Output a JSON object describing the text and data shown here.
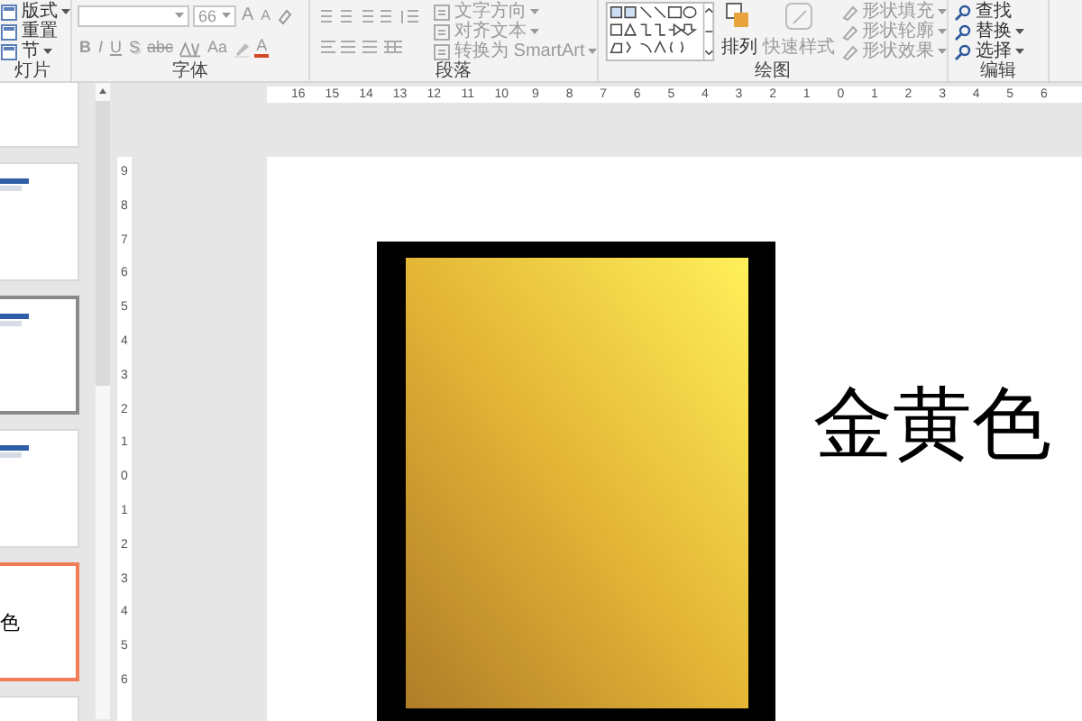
{
  "ribbon": {
    "groups": [
      {
        "kind": "slides",
        "label": "灯片",
        "buttons": [
          {
            "label": "版式",
            "dropdown": true
          },
          {
            "label": "重置",
            "dropdown": false
          },
          {
            "label": "节",
            "dropdown": true
          }
        ]
      },
      {
        "kind": "font",
        "label": "字体",
        "disabled": true,
        "font_size": {
          "value": "66"
        },
        "size_buttons": [
          {
            "label": "A",
            "kind": "grow"
          },
          {
            "label": "A",
            "kind": "shrink"
          }
        ],
        "format_buttons": [
          {
            "label": "B",
            "kind": "bold"
          },
          {
            "label": "I",
            "kind": "italic"
          },
          {
            "label": "U",
            "kind": "underline"
          },
          {
            "label": "S",
            "kind": "shadow"
          },
          {
            "label": "abc",
            "kind": "strike"
          }
        ],
        "case_button": {
          "label": "Aa"
        },
        "color_button": {
          "label": "A"
        }
      },
      {
        "kind": "paragraph",
        "label": "段落",
        "disabled": true,
        "commands": [
          {
            "label": "文字方向",
            "dropdown": true
          },
          {
            "label": "对齐文本",
            "dropdown": true
          },
          {
            "label": "转换为 SmartArt",
            "dropdown": true
          }
        ]
      },
      {
        "kind": "drawing",
        "label": "绘图",
        "arrange": {
          "label": "排列",
          "disabled": false
        },
        "quick_styles": {
          "label": "快速样式",
          "disabled": true
        },
        "commands": [
          {
            "label": "形状填充",
            "disabled": true
          },
          {
            "label": "形状轮廓",
            "disabled": true
          },
          {
            "label": "形状效果",
            "disabled": true
          }
        ]
      },
      {
        "kind": "editing",
        "label": "编辑",
        "commands": [
          {
            "label": "查找",
            "dropdown": false
          },
          {
            "label": "替换",
            "dropdown": true
          },
          {
            "label": "选择",
            "dropdown": true
          }
        ]
      }
    ]
  },
  "slide_panel": {
    "thumbnails": [
      {
        "kind": "blank",
        "selected": false,
        "hovered": false
      },
      {
        "kind": "title-bar",
        "selected": false,
        "hovered": false
      },
      {
        "kind": "title-bar",
        "selected": false,
        "hovered": true
      },
      {
        "kind": "title-bar",
        "selected": false,
        "hovered": false
      },
      {
        "kind": "text",
        "text": "色",
        "selected": true,
        "hovered": false
      },
      {
        "kind": "blank",
        "selected": false,
        "hovered": false
      }
    ]
  },
  "rulers": {
    "horizontal": [
      "16",
      "15",
      "14",
      "13",
      "12",
      "11",
      "10",
      "9",
      "8",
      "7",
      "6",
      "5",
      "4",
      "3",
      "2",
      "1",
      "0",
      "1",
      "2",
      "3",
      "4",
      "5",
      "6"
    ],
    "vertical": [
      "9",
      "8",
      "7",
      "6",
      "5",
      "4",
      "3",
      "2",
      "1",
      "0",
      "1",
      "2",
      "3",
      "4",
      "5",
      "6"
    ]
  },
  "slide": {
    "text": "金黄色"
  }
}
